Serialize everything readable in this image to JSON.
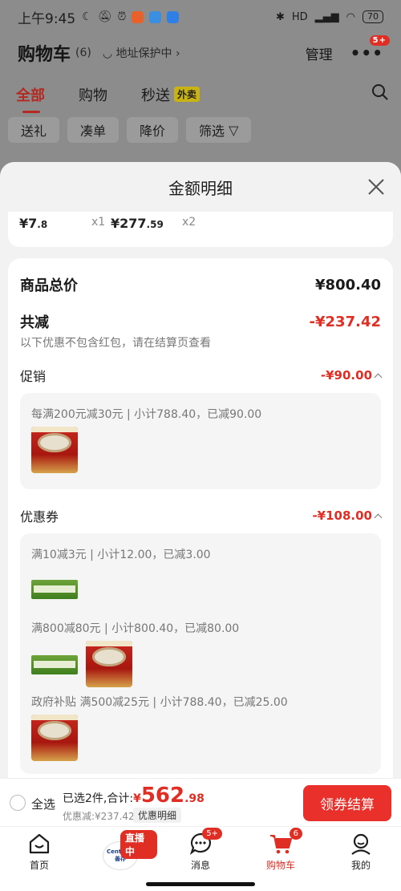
{
  "status_bar": {
    "time": "上午9:45",
    "battery": "70",
    "network": "HD"
  },
  "header": {
    "title": "购物车",
    "count": "(6)",
    "address": "地址保护中",
    "manage": "管理",
    "more_badge": "5+"
  },
  "tabs": [
    {
      "label": "全部"
    },
    {
      "label": "购物"
    },
    {
      "label": "秒送"
    }
  ],
  "tab_flash_badge": "外卖",
  "filters": [
    {
      "label": "送礼"
    },
    {
      "label": "凑单"
    },
    {
      "label": "降价"
    },
    {
      "label": "筛选"
    }
  ],
  "sheet": {
    "title": "金额明细",
    "items": [
      {
        "yen": "¥",
        "int": "7",
        "dec": ".8",
        "qty": "x1"
      },
      {
        "yen": "¥",
        "int": "277",
        "dec": ".59",
        "qty": "x2"
      }
    ],
    "total_label": "商品总价",
    "total_value": "¥800.40",
    "reduce_label": "共减",
    "reduce_value": "-¥237.42",
    "note": "以下优惠不包含红包，请在结算页查看",
    "promo": {
      "label": "促销",
      "amount": "-¥90.00",
      "rules": [
        {
          "text": "每满200元减30元 | 小计788.40，已减90.00"
        }
      ]
    },
    "coupon": {
      "label": "优惠券",
      "amount": "-¥108.00",
      "rules": [
        {
          "text": "满10减3元 | 小计12.00，已减3.00"
        },
        {
          "text": "满800减80元 | 小计800.40，已减80.00"
        },
        {
          "text": "政府补贴 满500减25元 | 小计788.40，已减25.00"
        }
      ]
    }
  },
  "checkout": {
    "select_all": "全选",
    "summary_prefix": "已选2件,合计:",
    "yen": "¥",
    "total_int": "562",
    "total_dec": ".98",
    "discount": "优惠减:¥237.42",
    "detail_button": "优惠明细",
    "pay_button": "领券结算"
  },
  "bottom_nav": {
    "home": "首页",
    "live_badge": "直播中",
    "live_brand": "善存",
    "messages": "消息",
    "messages_badge": "5+",
    "cart": "购物车",
    "cart_badge": "6",
    "me": "我的"
  },
  "colors": {
    "accent_red": "#e02e24",
    "pay_button": "#e9302a",
    "dim_overlay": "#8c8c8c"
  }
}
